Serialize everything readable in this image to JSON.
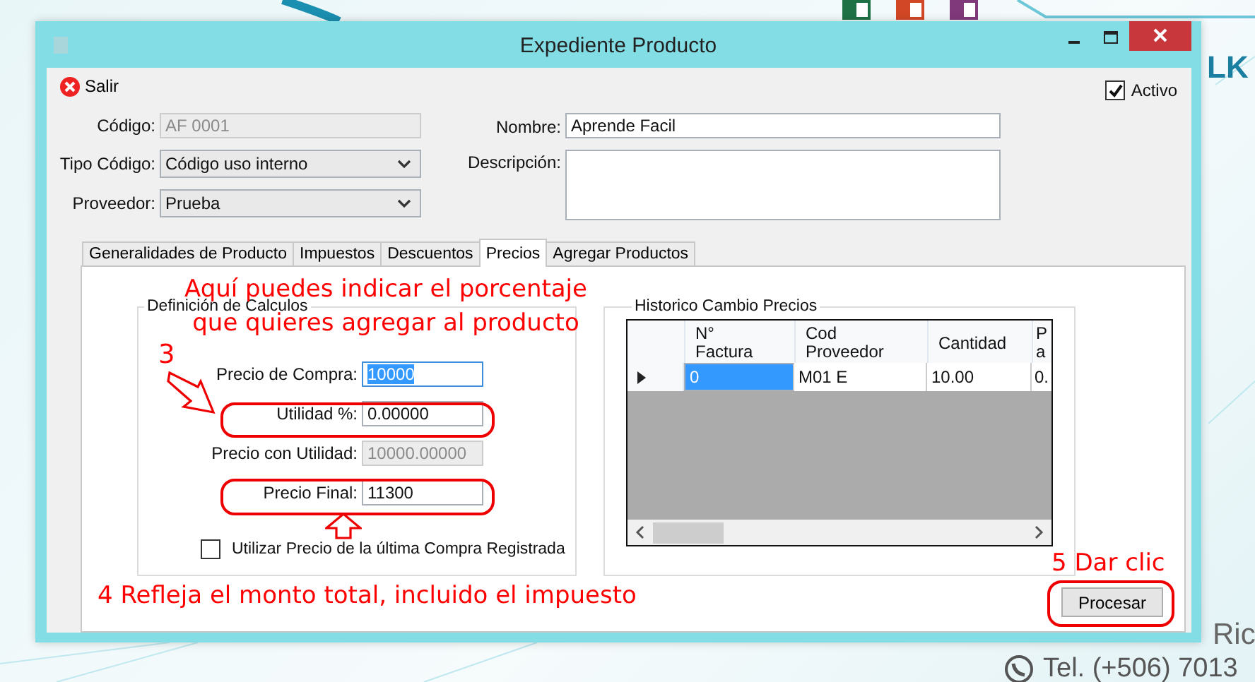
{
  "desktop": {
    "brand_fragment": "LK",
    "address_fragment": "Ric",
    "phone": "Tel. (+506) 7013"
  },
  "window": {
    "title": "Expediente Producto"
  },
  "toolbar": {
    "exit_label": "Salir",
    "active": {
      "label": "Activo",
      "checked": true
    }
  },
  "header_form": {
    "codigo": {
      "label": "Código:",
      "value": "AF 0001",
      "disabled": true
    },
    "tipo_codigo": {
      "label": "Tipo Código:",
      "value": "Código uso interno"
    },
    "proveedor": {
      "label": "Proveedor:",
      "value": "Prueba"
    },
    "nombre": {
      "label": "Nombre:",
      "value": "Aprende Facil"
    },
    "descripcion": {
      "label": "Descripción:"
    }
  },
  "tabs": [
    {
      "label": "Generalidades de Producto",
      "selected": false
    },
    {
      "label": "Impuestos",
      "selected": false
    },
    {
      "label": "Descuentos",
      "selected": false
    },
    {
      "label": "Precios",
      "selected": true
    },
    {
      "label": "Agregar Productos",
      "selected": false
    }
  ],
  "calculos": {
    "title": "Definición de Calculos",
    "fields": [
      {
        "label": "Precio de Compra:",
        "value": "10000",
        "disabled": false,
        "text_selected": true
      },
      {
        "label": "Utilidad %:",
        "value": "0.00000",
        "disabled": false,
        "text_selected": false
      },
      {
        "label": "Precio con Utilidad:",
        "value": "10000.00000",
        "disabled": true,
        "text_selected": false
      },
      {
        "label": "Precio Final:",
        "value": "11300",
        "disabled": false,
        "text_selected": false
      }
    ],
    "last_price_option": {
      "label": "Utilizar Precio de la última Compra Registrada",
      "checked": false
    }
  },
  "historico": {
    "title": "Historico Cambio Precios",
    "columns": [
      "N°\nFactura",
      "Cod\nProveedor",
      "Cantidad",
      "P\na"
    ],
    "rows": [
      {
        "current": true,
        "cells": [
          {
            "text": "0",
            "selected": true
          },
          {
            "text": "M01 E",
            "selected": false
          },
          {
            "text": "10.00",
            "selected": false
          },
          {
            "text": "0.",
            "selected": false
          }
        ]
      }
    ]
  },
  "process_button": "Procesar",
  "annotations": {
    "percent_hint": [
      "Aquí puedes indicar el porcentaje",
      "que quieres agregar al producto"
    ],
    "step_3": "3",
    "step_4": "4 Refleja el monto total, incluido el impuesto",
    "step_5": "5 Dar clic"
  }
}
